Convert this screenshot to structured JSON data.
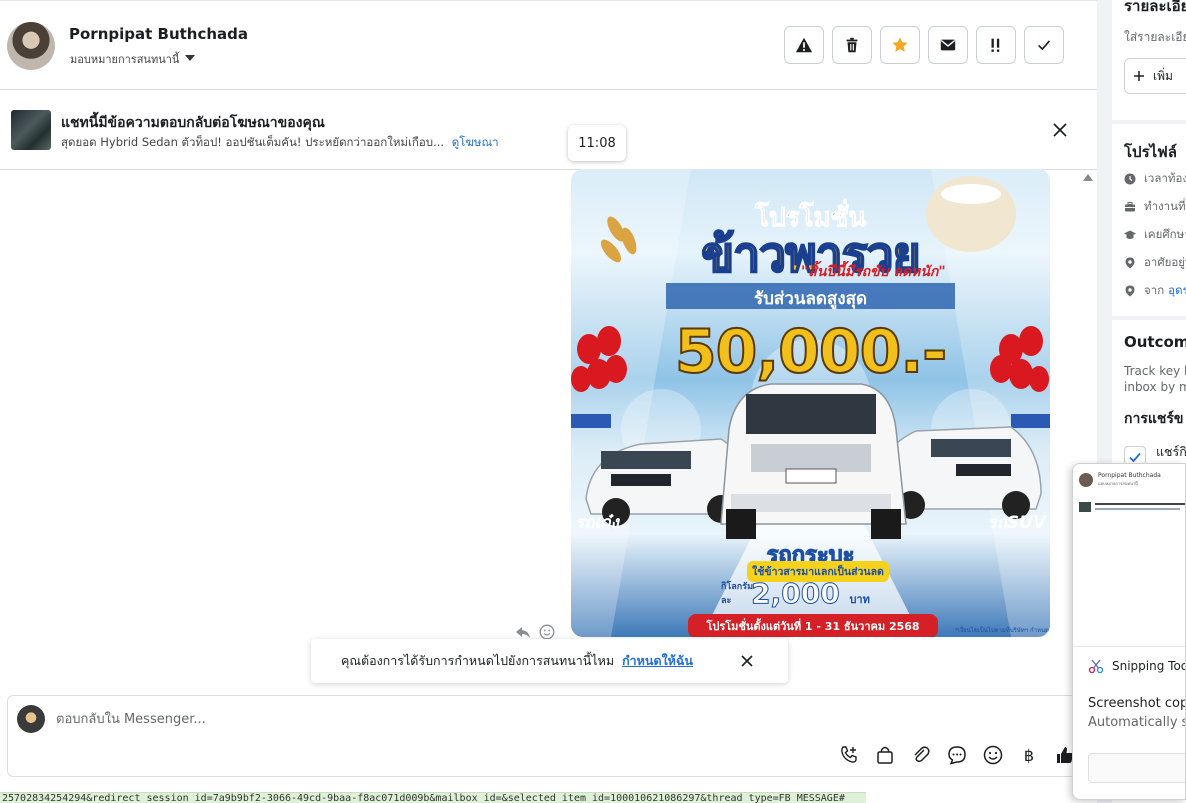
{
  "header": {
    "contact_name": "Pornpipat Buthchada",
    "assign_label": "มอบหมายการสนทนานี้",
    "actions": [
      "warning-icon",
      "trash-icon",
      "star-icon",
      "mail-icon",
      "important-icon",
      "check-icon"
    ]
  },
  "ad_banner": {
    "title": "แชทนี้มีข้อความตอบกลับต่อโฆษณาของคุณ",
    "subtitle": "สุดยอด Hybrid Sedan ตัวท็อป! ออปชันเต็มคัน! ประหยัดกว่าออกใหม่เกือบ...",
    "link": "ดูโฆษณา"
  },
  "message": {
    "time": "11:08",
    "promo": {
      "line1": "โปรโมชั่น",
      "line2": "ข้าวพารวย",
      "line3": "\"สิ้นปีนี้มีรถขับ ลดหนัก\"",
      "line4": "รับส่วนลดสูงสุด",
      "amount": "50,000.-",
      "left_label": "รถเก๋ง",
      "right_label": "รถSUV",
      "center_label": "รถกระบะ",
      "rice_offer": "ใช้ข้าวสารมาแลกเป็นส่วนลด",
      "per_kg": "กิโลกรัมละ",
      "price": "2,000",
      "unit": "บาท",
      "period": "โปรโมชั่นตั้งแต่วันที่ 1 - 31 ธันวาคม 2568",
      "note": "*เงื่อนไขเป็นไปตามที่บริษัทฯ กำหนด"
    }
  },
  "reminder": {
    "text": "คุณต้องการได้รับการกำหนดไปยังการสนทนานี้ไหม",
    "link": "กำหนดให้ฉัน"
  },
  "composer": {
    "placeholder": "ตอบกลับใน Messenger...",
    "currency": "฿"
  },
  "status_url": "25702834254294&redirect_session_id=7a9b9bf2-3066-49cd-9baa-f8ac071d009b&mailbox_id=&selected_item_id=100010621086297&thread_type=FB_MESSAGE#",
  "right_panel": {
    "details_title": "รายละเอียด",
    "details_placeholder": "ใส่รายละเอียด",
    "add_button": "เพิ่ม",
    "profile_title": "โปรไฟล์",
    "profile_rows": [
      {
        "icon": "clock-icon",
        "text": "เวลาท้องถิ่น"
      },
      {
        "icon": "briefcase-icon",
        "text": "ทำงานที่"
      },
      {
        "icon": "graduation-icon",
        "text": "เคยศึกษา"
      },
      {
        "icon": "location-icon",
        "text": "อาศัยอยู่ที่"
      },
      {
        "icon": "location-icon",
        "text": "จาก",
        "link": "อุดร"
      }
    ],
    "outcome_title": "Outcomes",
    "outcome_desc_1": "Track key b",
    "outcome_desc_2": "inbox by ma",
    "sharing_title": "การแชร์ข",
    "sharing_item": "แชร์กิ"
  },
  "snipping_tool": {
    "app_name": "Snipping Tool",
    "message": "Screenshot copied",
    "sub": "Automatically saved",
    "mini_name": "Pornpipat Buthchada"
  }
}
